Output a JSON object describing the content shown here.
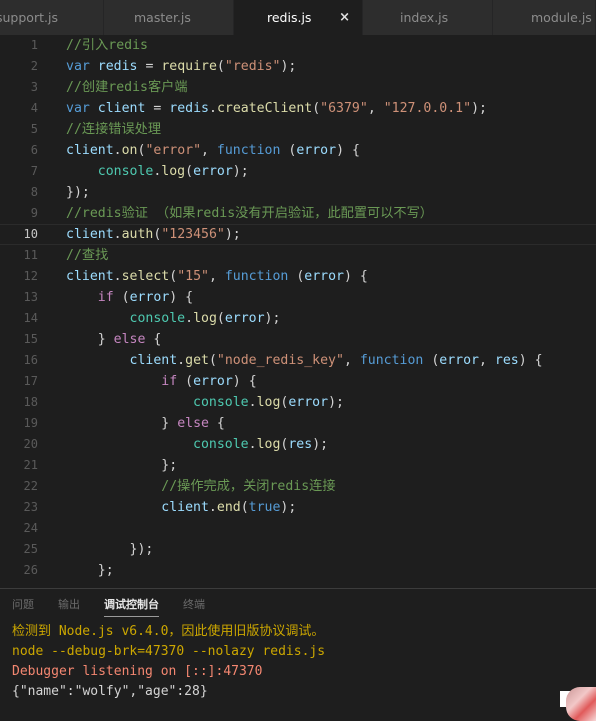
{
  "tabs": [
    {
      "label": "support.js",
      "active": false
    },
    {
      "label": "master.js",
      "active": false
    },
    {
      "label": "redis.js",
      "active": true,
      "close_icon": "×"
    },
    {
      "label": "index.js",
      "active": false
    },
    {
      "label": "module.js",
      "active": false
    }
  ],
  "editor": {
    "current_line": 10,
    "line_numbers": [
      "1",
      "2",
      "3",
      "4",
      "5",
      "6",
      "7",
      "8",
      "9",
      "10",
      "11",
      "12",
      "13",
      "14",
      "15",
      "16",
      "17",
      "18",
      "19",
      "20",
      "21",
      "22",
      "23",
      "24",
      "25",
      "26"
    ],
    "lines": [
      "//引入redis",
      "var redis = require(\"redis\");",
      "//创建redis客户端",
      "var client = redis.createClient(\"6379\", \"127.0.0.1\");",
      "//连接错误处理",
      "client.on(\"error\", function (error) {",
      "    console.log(error);",
      "});",
      "//redis验证 （如果redis没有开启验证，此配置可以不写）",
      "client.auth(\"123456\");",
      "//查找",
      "client.select(\"15\", function (error) {",
      "    if (error) {",
      "        console.log(error);",
      "    } else {",
      "        client.get(\"node_redis_key\", function (error, res) {",
      "            if (error) {",
      "                console.log(error);",
      "            } else {",
      "                console.log(res);",
      "            };",
      "            //操作完成，关闭redis连接",
      "            client.end(true);",
      "",
      "        });",
      "    };"
    ]
  },
  "panel": {
    "tabs": [
      {
        "label": "问题",
        "active": false
      },
      {
        "label": "输出",
        "active": false
      },
      {
        "label": "调试控制台",
        "active": true
      },
      {
        "label": "终端",
        "active": false
      }
    ],
    "output": [
      {
        "text": "检测到 Node.js v6.4.0，因此使用旧版协议调试。",
        "kind": "warn"
      },
      {
        "text": "node --debug-brk=47370 --nolazy redis.js",
        "kind": "warn"
      },
      {
        "text": "Debugger listening on [::]:47370",
        "kind": "err"
      },
      {
        "text": "{\"name\":\"wolfy\",\"age\":28}",
        "kind": "plain"
      }
    ]
  },
  "colors": {
    "background": "#1e1e1e",
    "keyword": "#569cd6",
    "string": "#ce9178",
    "comment": "#6a9955",
    "variable": "#9cdcfe",
    "function": "#dcdcaa",
    "warning": "#cca700",
    "error": "#f48771"
  }
}
